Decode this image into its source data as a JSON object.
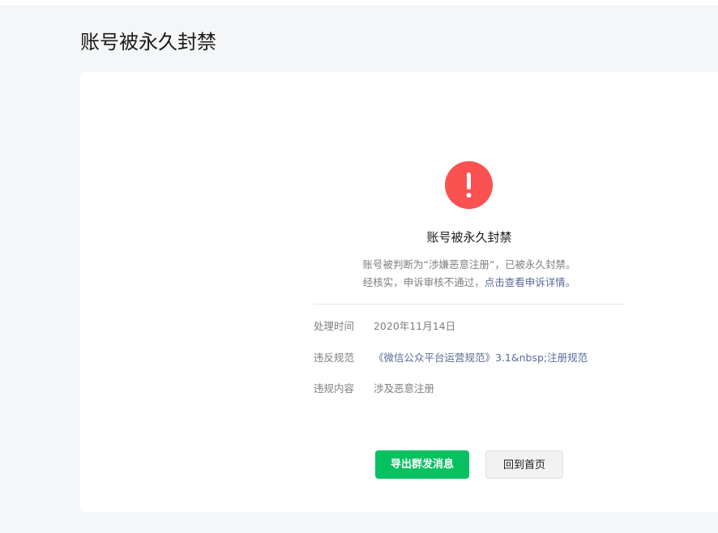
{
  "page": {
    "title": "账号被永久封禁"
  },
  "notice": {
    "icon": "exclamation-icon",
    "icon_color": "#fa5151",
    "heading": "账号被永久封禁",
    "desc_line1": "账号被判断为“涉嫌恶意注册”，已被永久封禁。",
    "desc_line2_prefix": "经核实，申诉审核不通过，",
    "desc_line2_link": "点击查看申诉详情。"
  },
  "details": {
    "time_label": "处理时间",
    "time_value": "2020年11月14日",
    "rule_label": "违反规范",
    "rule_value": "《微信公众平台运营规范》3.1&nbsp;注册规范",
    "content_label": "违规内容",
    "content_value": "涉及恶意注册"
  },
  "actions": {
    "export_label": "导出群发消息",
    "home_label": "回到首页"
  },
  "colors": {
    "primary": "#07c160",
    "danger": "#fa5151",
    "link": "#576b95"
  }
}
